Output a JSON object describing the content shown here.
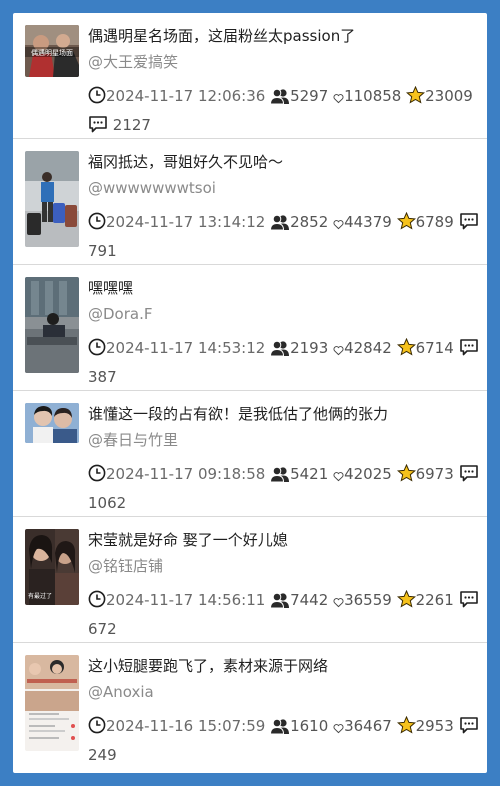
{
  "posts": [
    {
      "title": "偶遇明星名场面，这届粉丝太passion了",
      "author": "@大王爱搞笑",
      "time": "2024-11-17 12:06:36",
      "views": "5297",
      "likes": "110858",
      "favorites": "23009",
      "comments": "2127",
      "thumb_caption": "偶遇明星场面"
    },
    {
      "title": "福冈抵达，哥姐好久不见哈～",
      "author": "@wwwwwwwtsoi",
      "time": "2024-11-17 13:14:12",
      "views": "2852",
      "likes": "44379",
      "favorites": "6789",
      "comments": "791"
    },
    {
      "title": "嘿嘿嘿",
      "author": "@Dora.F",
      "time": "2024-11-17 14:53:12",
      "views": "2193",
      "likes": "42842",
      "favorites": "6714",
      "comments": "387"
    },
    {
      "title": "谁懂这一段的占有欲！是我低估了他俩的张力",
      "author": "@春日与竹里",
      "time": "2024-11-17 09:18:58",
      "views": "5421",
      "likes": "42025",
      "favorites": "6973",
      "comments": "1062"
    },
    {
      "title": "宋莹就是好命 娶了一个好儿媳",
      "author": "@铭钰店铺",
      "time": "2024-11-17 14:56:11",
      "views": "7442",
      "likes": "36559",
      "favorites": "2261",
      "comments": "672",
      "thumb_caption": "有最过了"
    },
    {
      "title": "这小短腿要跑飞了，素材来源于网络",
      "author": "@Anoxia",
      "time": "2024-11-16 15:07:59",
      "views": "1610",
      "likes": "36467",
      "favorites": "2953",
      "comments": "249"
    }
  ],
  "icons": {
    "time": "clock-icon",
    "views": "people-icon",
    "likes": "heart-icon",
    "favorites": "star-icon",
    "comments": "comment-icon"
  },
  "colors": {
    "background": "#3c7fc4",
    "star": "#f6c21c"
  }
}
